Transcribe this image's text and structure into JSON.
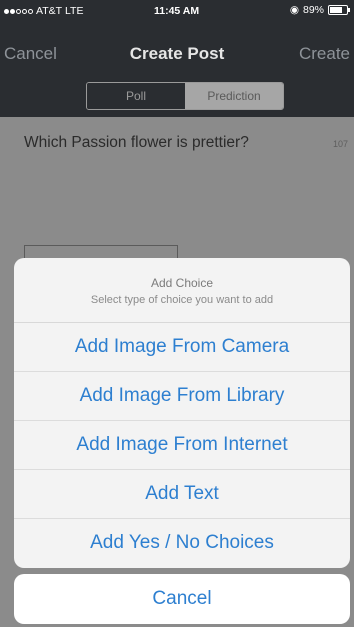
{
  "status_bar": {
    "carrier": "AT&T",
    "network": "LTE",
    "time": "11:45 AM",
    "battery": "89%",
    "battery_level": 0.89
  },
  "nav": {
    "cancel_label": "Cancel",
    "title": "Create Post",
    "create_label": "Create"
  },
  "segments": {
    "poll_label": "Poll",
    "prediction_label": "Prediction"
  },
  "question": {
    "text": "Which Passion flower is prettier?",
    "char_count": "107"
  },
  "action_sheet": {
    "title": "Add Choice",
    "subtitle": "Select type of choice you want to add",
    "actions": [
      "Add Image From Camera",
      "Add Image From Library",
      "Add Image From Internet",
      "Add Text",
      "Add Yes / No Choices"
    ],
    "cancel_label": "Cancel"
  },
  "colors": {
    "action_blue": "#2d7fd0",
    "navbar_bg": "#2a2d31",
    "dim_overlay": "#8b8b8b"
  }
}
